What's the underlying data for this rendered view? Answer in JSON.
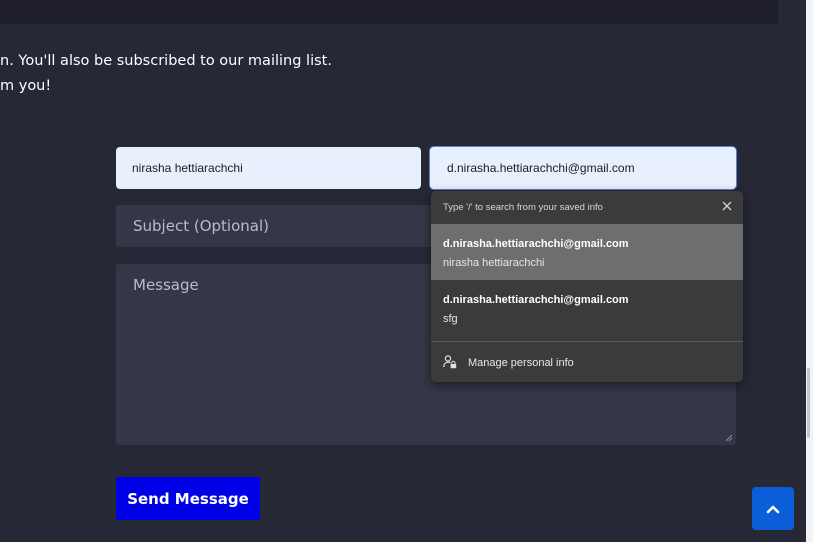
{
  "intro": {
    "line1": "n. You'll also be subscribed to our mailing list.",
    "line2": "m you!"
  },
  "form": {
    "name_value": "nirasha hettiarachchi",
    "email_value": "d.nirasha.hettiarachchi@gmail.com",
    "subject_placeholder": "Subject (Optional)",
    "message_placeholder": "Message",
    "send_label": "Send Message"
  },
  "autofill": {
    "hint": "Type '/' to search from your saved info",
    "suggestions": [
      {
        "primary": "d.nirasha.hettiarachchi@gmail.com",
        "secondary": "nirasha hettiarachchi"
      },
      {
        "primary": "d.nirasha.hettiarachchi@gmail.com",
        "secondary": "sfg"
      }
    ],
    "manage_label": "Manage personal info"
  },
  "colors": {
    "background": "#262836",
    "input_filled": "#e8f0fe",
    "input_dark": "#343747",
    "send_button": "#0000e6",
    "back_to_top": "#0b5ed7",
    "autofill_bg": "#3b3b3b",
    "autofill_selected": "#6e6e6e"
  },
  "icons": {
    "close": "close-icon",
    "manage": "person-lock-icon",
    "back_to_top": "chevron-up-icon",
    "resize": "resize-grip-icon"
  }
}
